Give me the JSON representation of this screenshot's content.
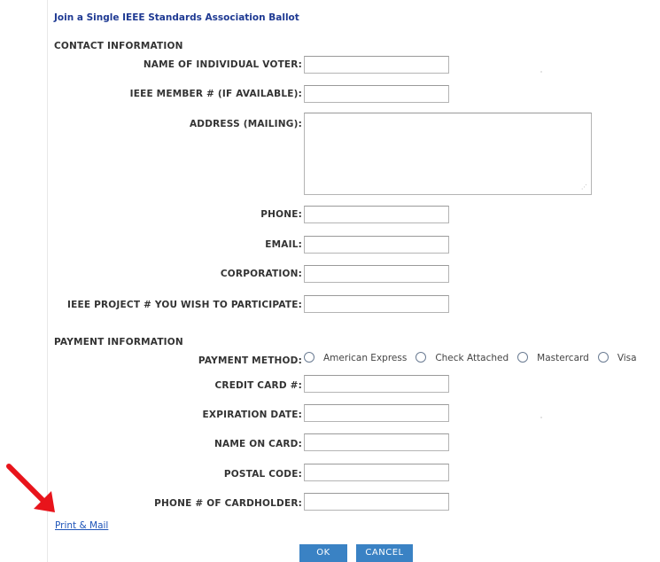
{
  "form": {
    "title": "Join a Single IEEE Standards Association Ballot",
    "contact_section": "CONTACT INFORMATION",
    "payment_section": "PAYMENT INFORMATION",
    "labels": {
      "name": "NAME OF INDIVIDUAL VOTER:",
      "member": "IEEE MEMBER # (IF AVAILABLE):",
      "address": "ADDRESS (MAILING):",
      "phone": "PHONE:",
      "email": "EMAIL:",
      "corporation": "CORPORATION:",
      "project": "IEEE PROJECT # YOU WISH TO PARTICIPATE:",
      "payment_method": "PAYMENT METHOD:",
      "credit_card": "CREDIT CARD #:",
      "expiration": "EXPIRATION DATE:",
      "name_on_card": "NAME ON CARD:",
      "postal_code": "POSTAL CODE:",
      "phone_cardholder": "PHONE # OF CARDHOLDER:"
    },
    "values": {
      "name": "",
      "member": "",
      "address": "",
      "phone": "",
      "email": "",
      "corporation": "",
      "project": "",
      "credit_card": "",
      "expiration": "",
      "name_on_card": "",
      "postal_code": "",
      "phone_cardholder": ""
    },
    "payment_options": [
      "American Express",
      "Check Attached",
      "Mastercard",
      "Visa"
    ],
    "print_mail_link": "Print & Mail",
    "ok_button": "OK",
    "cancel_button": "CANCEL"
  },
  "colors": {
    "title": "#1f3a93",
    "link": "#1f55b9",
    "button_bg": "#3a82c4",
    "arrow": "#e8141b"
  },
  "icons": {
    "arrow": "red-arrow-icon",
    "resize_grip": "resize-grip-icon"
  }
}
